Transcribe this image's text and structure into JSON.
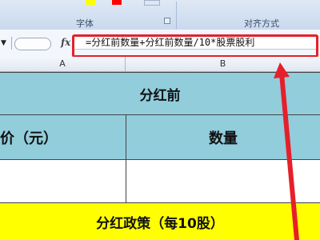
{
  "ribbon": {
    "font_group_label": "字体",
    "alignment_group_label": "对齐方式",
    "colors": {
      "fill_yellow": "#ffff00",
      "font_red": "#ff0000"
    }
  },
  "formula_bar": {
    "fx_label": "fx",
    "formula": "=分红前数量+分红前数量/10*股票股利"
  },
  "columns": {
    "a": "A",
    "b": "B"
  },
  "sheet": {
    "title": "分红前",
    "price_header": "股价（元）",
    "qty_header": "数量",
    "policy_header": "分红政策（每10股）"
  },
  "colors": {
    "header_fill": "#92cddc",
    "policy_fill": "#ffff00",
    "annotation_red": "#e5202a"
  }
}
